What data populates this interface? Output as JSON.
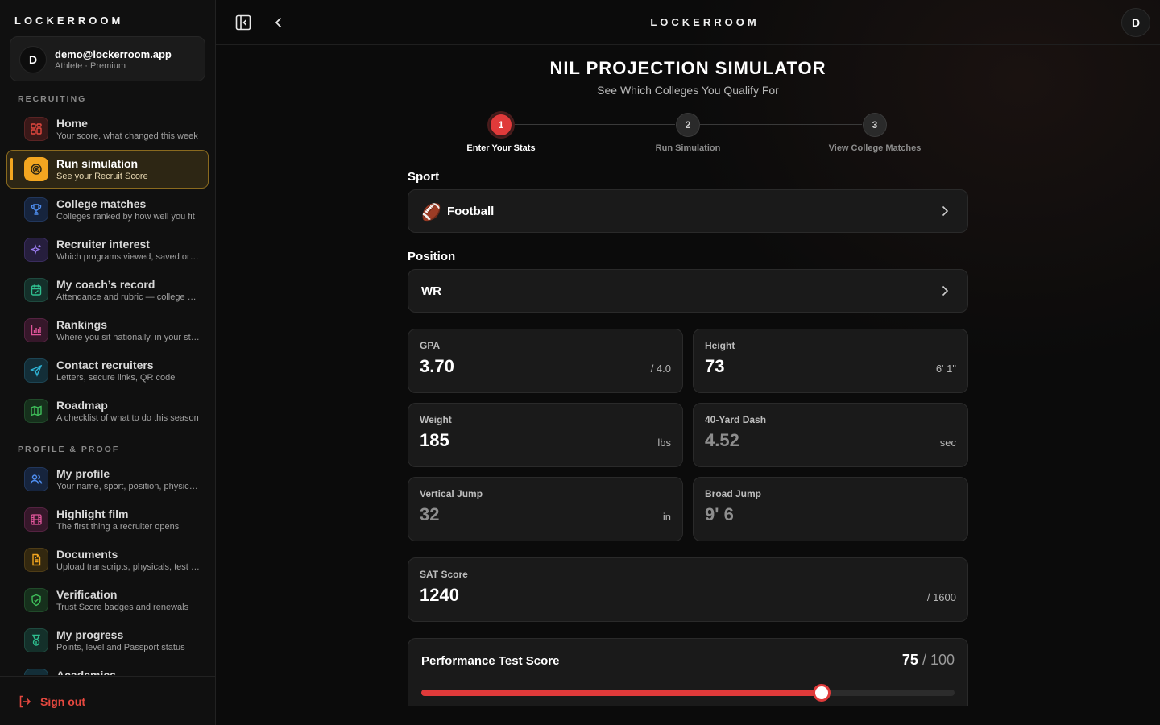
{
  "app": {
    "brand": "LOCKERROOM"
  },
  "account": {
    "initial": "D",
    "email": "demo@lockerroom.app",
    "plan": "Athlete · Premium"
  },
  "sidebar": {
    "sections": [
      {
        "label": "RECRUITING",
        "items": [
          {
            "title": "Home",
            "subtitle": "Your score, what changed this week",
            "icon": "grid-icon",
            "color": "#e5483f",
            "active": false
          },
          {
            "title": "Run simulation",
            "subtitle": "See your Recruit Score",
            "icon": "target-icon",
            "color": "#f3a620",
            "active": true
          },
          {
            "title": "College matches",
            "subtitle": "Colleges ranked by how well you fit",
            "icon": "trophy-icon",
            "color": "#4f8ef0",
            "active": false
          },
          {
            "title": "Recruiter interest",
            "subtitle": "Which programs viewed, saved or contacted you",
            "icon": "sparkles-icon",
            "color": "#9b7cf0",
            "active": false
          },
          {
            "title": "My coach’s record",
            "subtitle": "Attendance and rubric — college coaches see this",
            "icon": "calendar-check-icon",
            "color": "#2fbf8f",
            "active": false
          },
          {
            "title": "Rankings",
            "subtitle": "Where you sit nationally, in your state",
            "icon": "bar-chart-icon",
            "color": "#e0559a",
            "active": false
          },
          {
            "title": "Contact recruiters",
            "subtitle": "Letters, secure links, QR code",
            "icon": "send-icon",
            "color": "#2fb4d6",
            "active": false
          },
          {
            "title": "Roadmap",
            "subtitle": "A checklist of what to do this season",
            "icon": "map-icon",
            "color": "#3fbf5a",
            "active": false
          }
        ]
      },
      {
        "label": "PROFILE & PROOF",
        "items": [
          {
            "title": "My profile",
            "subtitle": "Your name, sport, position, physicals",
            "icon": "users-icon",
            "color": "#4f8ef0",
            "active": false
          },
          {
            "title": "Highlight film",
            "subtitle": "The first thing a recruiter opens",
            "icon": "film-icon",
            "color": "#e0559a",
            "active": false
          },
          {
            "title": "Documents",
            "subtitle": "Upload transcripts, physicals, test scores",
            "icon": "document-icon",
            "color": "#f3a620",
            "active": false
          },
          {
            "title": "Verification",
            "subtitle": "Trust Score badges and renewals",
            "icon": "shield-check-icon",
            "color": "#3fbf5a",
            "active": false
          },
          {
            "title": "My progress",
            "subtitle": "Points, level and Passport status",
            "icon": "medal-icon",
            "color": "#2fbf8f",
            "active": false
          },
          {
            "title": "Academics",
            "subtitle": "",
            "icon": "book-icon",
            "color": "#2fb4d6",
            "active": false
          }
        ]
      }
    ],
    "signout": "Sign out"
  },
  "topbar": {
    "brand": "LOCKERROOM",
    "avatar": "D"
  },
  "page": {
    "title": "NIL PROJECTION SIMULATOR",
    "subtitle": "See Which Colleges You Qualify For",
    "steps": [
      {
        "num": "1",
        "label": "Enter Your Stats",
        "active": true
      },
      {
        "num": "2",
        "label": "Run Simulation",
        "active": false
      },
      {
        "num": "3",
        "label": "View College Matches",
        "active": false
      }
    ]
  },
  "form": {
    "sport": {
      "label": "Sport",
      "value": "Football",
      "icon": "🏈"
    },
    "position": {
      "label": "Position",
      "value": "WR"
    },
    "stats": [
      {
        "label": "GPA",
        "value": "3.70",
        "unit": "/ 4.0",
        "dim": false
      },
      {
        "label": "Height",
        "value": "73",
        "unit": "6' 1\"",
        "dim": false
      },
      {
        "label": "Weight",
        "value": "185",
        "unit": "lbs",
        "dim": false
      },
      {
        "label": "40-Yard Dash",
        "value": "4.52",
        "unit": "sec",
        "dim": true
      },
      {
        "label": "Vertical Jump",
        "value": "32",
        "unit": "in",
        "dim": true
      },
      {
        "label": "Broad Jump",
        "value": "9' 6",
        "unit": "",
        "dim": true
      }
    ],
    "sat": {
      "label": "SAT Score",
      "value": "1240",
      "unit": "/ 1600"
    },
    "performance": {
      "label": "Performance Test Score",
      "value": "75",
      "max": "/ 100",
      "fraction": 0.75
    }
  }
}
